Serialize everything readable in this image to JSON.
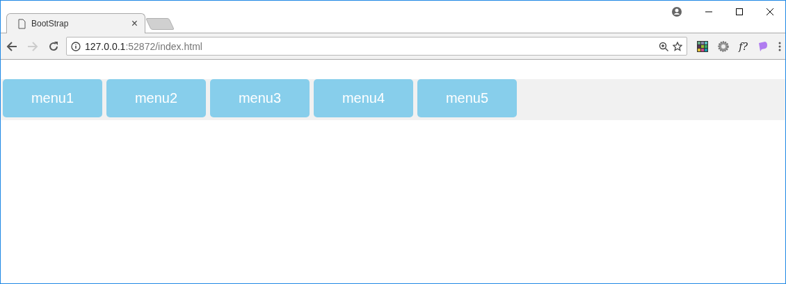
{
  "browser": {
    "tab_title": "BootStrap",
    "tab_close": "×",
    "url_host": "127.0.0.1",
    "url_path": ":52872/index.html",
    "extension_label": "f?"
  },
  "menu": [
    {
      "label": "menu1"
    },
    {
      "label": "menu2"
    },
    {
      "label": "menu3"
    },
    {
      "label": "menu4"
    },
    {
      "label": "menu5"
    }
  ]
}
